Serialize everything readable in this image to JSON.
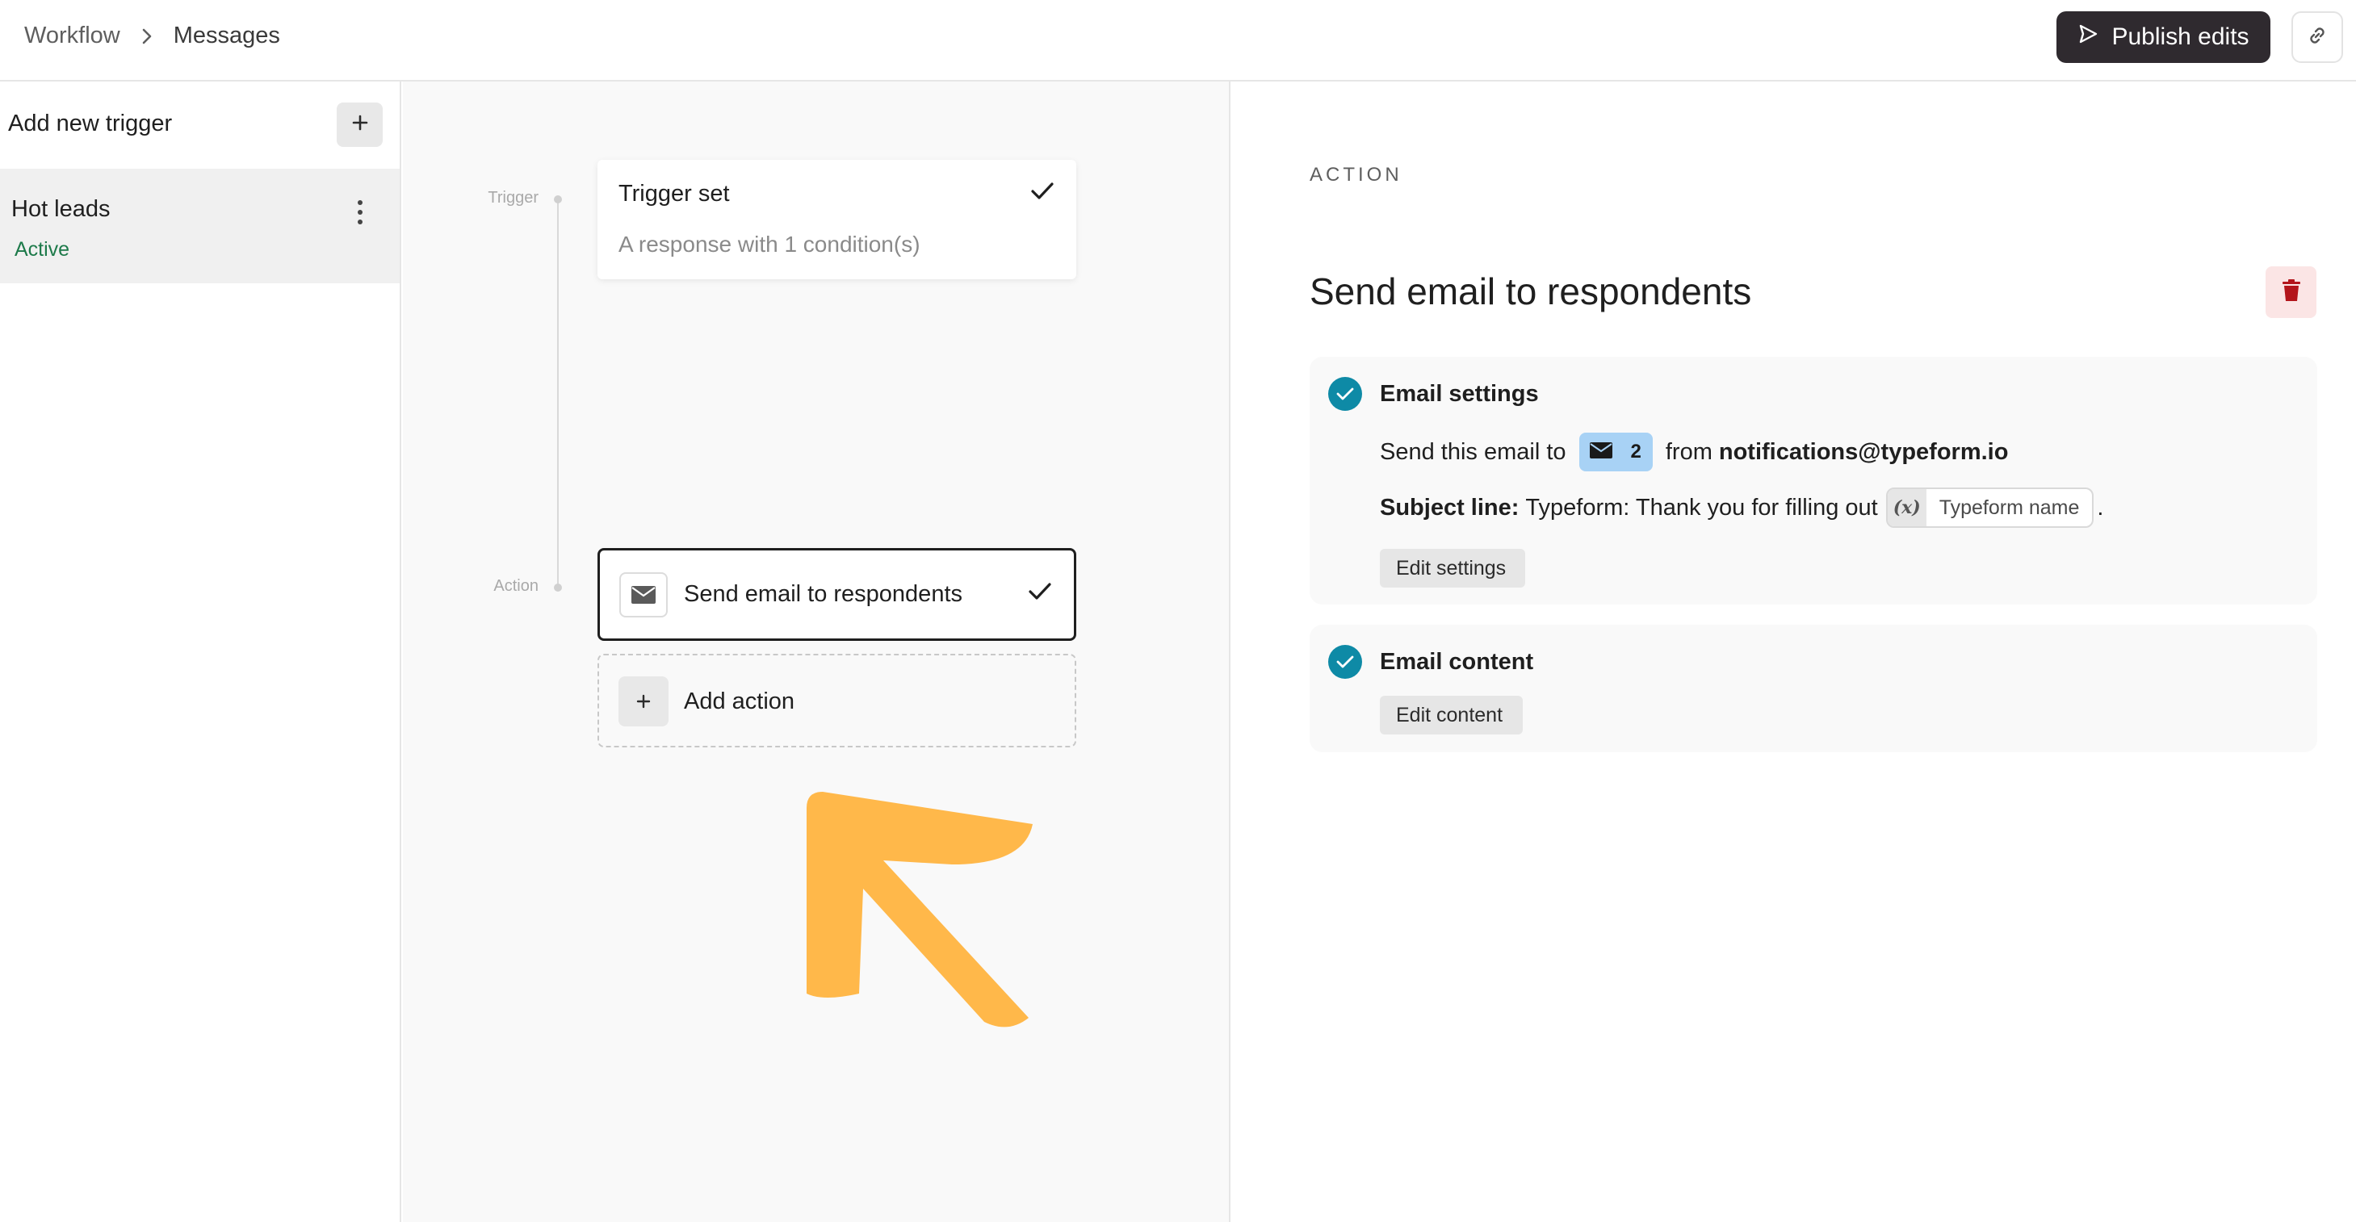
{
  "breadcrumb": {
    "items": [
      "Workflow",
      "Messages"
    ]
  },
  "header": {
    "publish_label": "Publish edits"
  },
  "sidebar": {
    "add_trigger_label": "Add new trigger",
    "triggers": [
      {
        "name": "Hot leads",
        "status": "Active"
      }
    ]
  },
  "canvas": {
    "timeline": {
      "trigger_label": "Trigger",
      "action_label": "Action"
    },
    "trigger_card": {
      "title": "Trigger set",
      "subtitle": "A response with 1 condition(s)"
    },
    "action_card": {
      "label": "Send email to respondents"
    },
    "add_action": {
      "label": "Add action"
    }
  },
  "panel": {
    "eyebrow": "ACTION",
    "title": "Send email to respondents",
    "email_settings": {
      "title": "Email settings",
      "send_to_prefix": "Send this email to",
      "recipient_count": "2",
      "from_prefix": "from",
      "from_address": "notifications@typeform.io",
      "subject_label": "Subject line:",
      "subject_text": "Typeform: Thank you for filling out",
      "variable_symbol": "(x)",
      "variable_name": "Typeform name",
      "subject_suffix": ".",
      "edit_label": "Edit settings"
    },
    "email_content": {
      "title": "Email content",
      "edit_label": "Edit content"
    }
  },
  "colors": {
    "publish_bg": "#2f2a2f",
    "active_status": "#1d7a4a",
    "check_badge": "#0e8aa6",
    "recipient_chip": "#a8d2f5",
    "delete_bg": "#fbe5e5",
    "delete_icon": "#b3151b",
    "annotation_arrow": "#ffb84a"
  },
  "icons": {
    "breadcrumb_separator": "chevron-right-icon",
    "publish": "send-icon",
    "share": "link-icon",
    "add": "plus-icon",
    "more": "kebab-icon",
    "done": "checkmark-icon",
    "email": "envelope-icon",
    "delete": "trash-icon",
    "annotation": "arrow-annotation-icon"
  }
}
